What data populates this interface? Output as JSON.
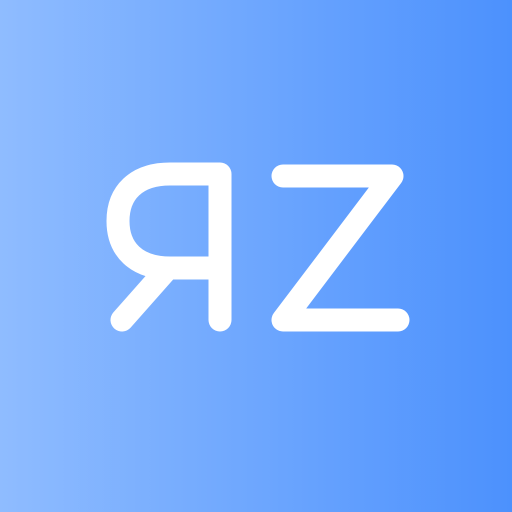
{
  "icon": {
    "logo_text": "ЯZ",
    "background_colors": [
      "#8fbcff",
      "#4c91fd"
    ],
    "glyph_color": "#ffffff"
  }
}
